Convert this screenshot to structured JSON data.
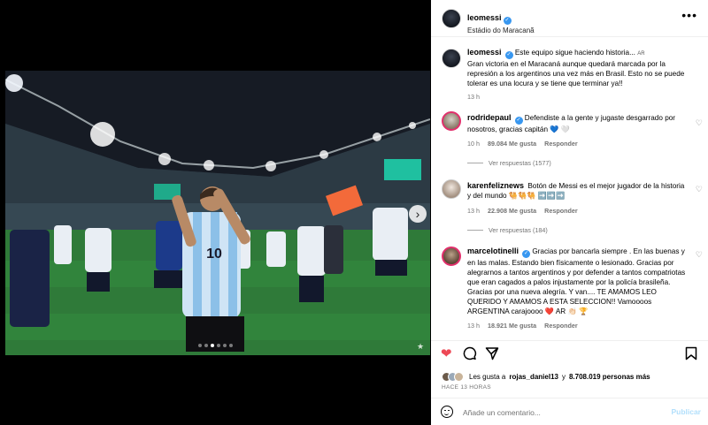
{
  "header": {
    "username": "leomessi",
    "location": "Estádio do Maracanã",
    "more_label": "•••"
  },
  "caption": {
    "username": "leomessi",
    "text": "Este equipo sigue haciendo historia... ",
    "flag": "AR",
    "text2": "Gran victoria en el Maracaná aunque quedará marcada por la represión a los argentinos una vez más en Brasil. Esto no se puede tolerar es una locura y se tiene que terminar ya!!",
    "time": "13 h"
  },
  "comments": [
    {
      "username": "rodridepaul",
      "text": "Defendiste a la gente y jugaste desgarrado por nosotros, gracias capitán 💙 🤍",
      "time": "10 h",
      "likes": "89.084 Me gusta",
      "reply": "Responder",
      "view_replies": "Ver respuestas (1577)"
    },
    {
      "username": "karenfeliznews",
      "text": "Botón de Messi es el mejor jugador de la historia y del mundo 🐫🐫🐫 ➡️➡️➡️",
      "time": "13 h",
      "likes": "22.908 Me gusta",
      "reply": "Responder",
      "view_replies": "Ver respuestas (184)"
    },
    {
      "username": "marcelotinelli",
      "text": "Gracias por bancarla siempre . En las buenas y en las malas. Estando bien físicamente o lesionado. Gracias por alegrarnos a tantos argentinos y por defender a tantos compatriotas que eran cagados a palos injustamente por la policía brasileña. Gracias por una nueva alegría. Y van.... TE AMAMOS LEO QUERIDO Y AMAMOS A ESTA SELECCION!! Vamoooos ARGENTINA carajoooo ❤️ AR 👏🏻 🏆",
      "time": "13 h",
      "likes": "18.921 Me gusta",
      "reply": "Responder"
    }
  ],
  "likes_summary": {
    "prefix": "Les gusta a ",
    "user": "rojas_daniel13",
    "middle": " y ",
    "count": "8.708.019 personas más"
  },
  "post_time": "HACE 13 HORAS",
  "add_comment": {
    "placeholder": "Añade un comentario...",
    "post_label": "Publicar"
  },
  "media": {
    "jersey_number": "10",
    "slide_count": 6,
    "active_slide": 2
  },
  "colors": {
    "like_red": "#ed4956",
    "verified_blue": "#3897f0",
    "post_blue": "#b2dffc"
  }
}
